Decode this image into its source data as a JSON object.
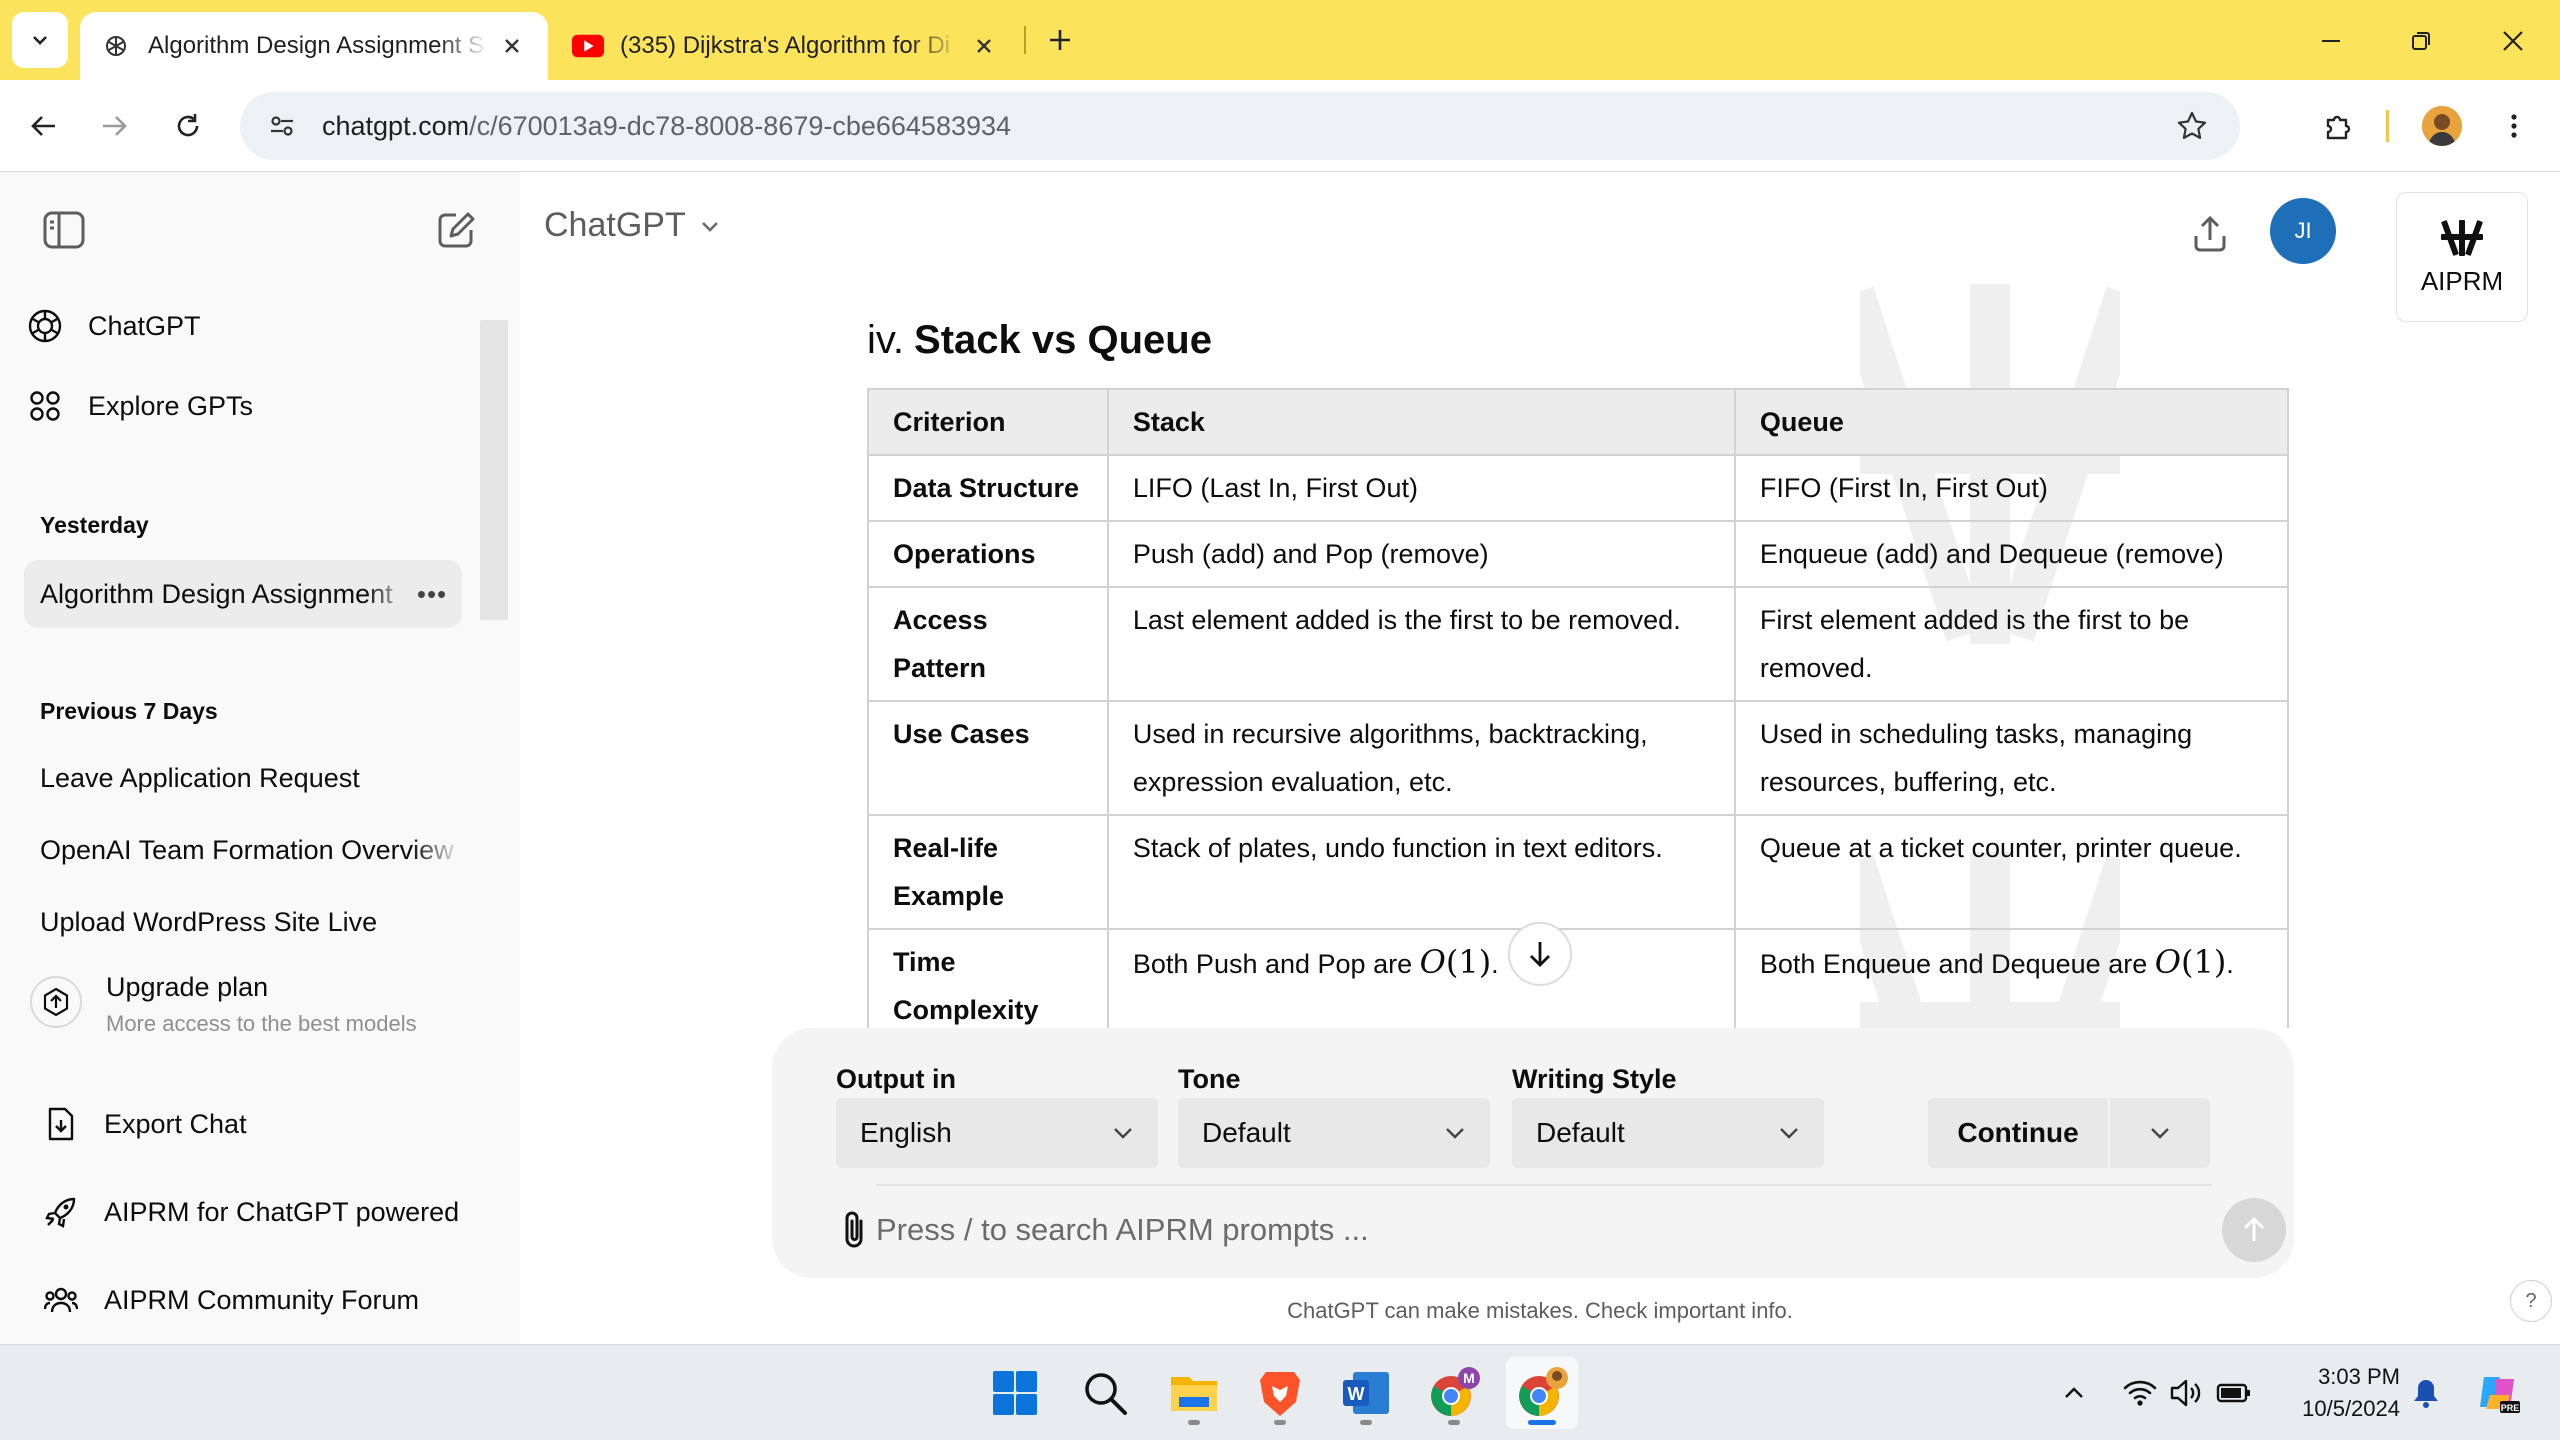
{
  "browser": {
    "tabs": [
      {
        "title": "Algorithm Design Assignment S",
        "active": true
      },
      {
        "title": "(335) Dijkstra's Algorithm for Di",
        "active": false
      }
    ],
    "url_host": "chatgpt.com",
    "url_path": "/c/670013a9-dc78-8008-8679-cbe664583934"
  },
  "sidebar": {
    "top_items": [
      {
        "label": "ChatGPT",
        "icon": "openai-logo-icon"
      },
      {
        "label": "Explore GPTs",
        "icon": "grid-icon"
      }
    ],
    "sections": [
      {
        "title": "Yesterday",
        "chats": [
          "Algorithm Design Assignment"
        ]
      },
      {
        "title": "Previous 7 Days",
        "chats": [
          "Leave Application Request",
          "OpenAI Team Formation Overview",
          "Upload WordPress Site Live"
        ]
      }
    ],
    "upgrade": {
      "title": "Upgrade plan",
      "subtitle": "More access to the best models"
    },
    "bottom_items": [
      {
        "label": "Export Chat",
        "icon": "export-file-icon"
      },
      {
        "label": "AIPRM for ChatGPT powered",
        "icon": "rocket-icon"
      },
      {
        "label": "AIPRM Community Forum",
        "icon": "community-icon"
      }
    ]
  },
  "header": {
    "model": "ChatGPT",
    "user_initials": "JI",
    "aiprm_label": "AIPRM"
  },
  "content": {
    "section_number": "iv.",
    "section_title": "Stack vs Queue",
    "table": {
      "headers": [
        "Criterion",
        "Stack",
        "Queue"
      ],
      "rows": [
        [
          "Data Structure",
          "LIFO (Last In, First Out)",
          "FIFO (First In, First Out)"
        ],
        [
          "Operations",
          "Push (add) and Pop (remove)",
          "Enqueue (add) and Dequeue (remove)"
        ],
        [
          "Access Pattern",
          "Last element added is the first to be removed.",
          "First element added is the first to be removed."
        ],
        [
          "Use Cases",
          "Used in recursive algorithms, backtracking, expression evaluation, etc.",
          "Used in scheduling tasks, managing resources, buffering, etc."
        ],
        [
          "Real-life Example",
          "Stack of plates, undo function in text editors.",
          "Queue at a ticket counter, printer queue."
        ]
      ],
      "complexity_row": {
        "criterion": "Time Complexity",
        "stack_prefix": "Both Push and Pop are",
        "queue_prefix": "Both Enqueue and Dequeue are",
        "math_symbol": "O",
        "math_arg": "(1)",
        "suffix": "."
      }
    }
  },
  "composer": {
    "output_label": "Output in",
    "output_value": "English",
    "tone_label": "Tone",
    "tone_value": "Default",
    "style_label": "Writing Style",
    "style_value": "Default",
    "continue_label": "Continue",
    "placeholder": "Press / to search AIPRM prompts ..."
  },
  "disclaimer": "ChatGPT can make mistakes. Check important info.",
  "help_label": "?",
  "taskbar": {
    "apps": [
      "start-icon",
      "search-icon",
      "file-explorer-icon",
      "brave-icon",
      "word-icon",
      "chrome-profile-m-icon",
      "chrome-icon"
    ],
    "time": "3:03 PM",
    "date": "10/5/2024"
  },
  "colors": {
    "tabbar": "#fbe35c",
    "sidebar": "#f9f9f9",
    "user_avatar": "#1e6fb8",
    "table_header": "#ececec",
    "composer": "#f4f4f4"
  }
}
